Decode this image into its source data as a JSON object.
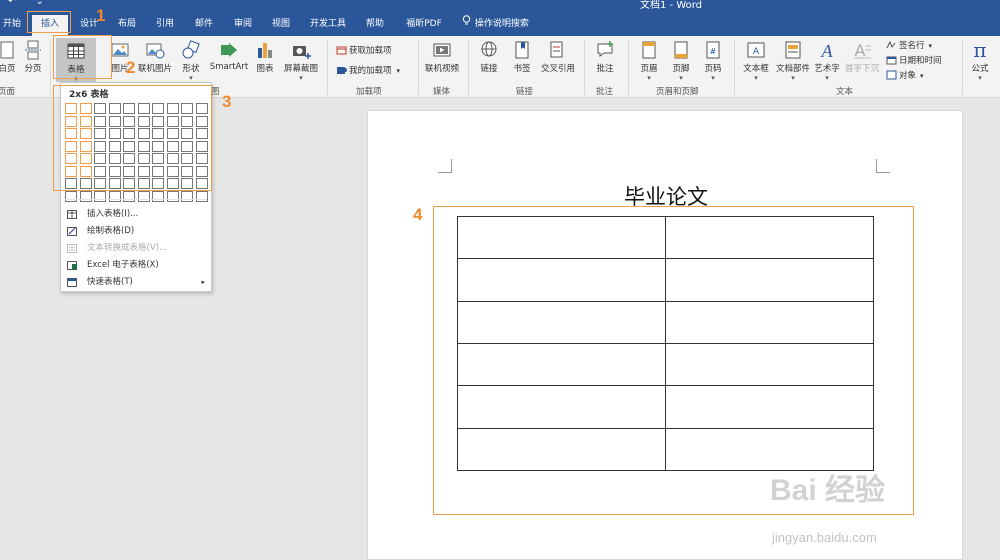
{
  "titlebar": {
    "title": "文档1 - Word",
    "quick_access": "↶ ⌄"
  },
  "tabs": [
    {
      "label": "开始"
    },
    {
      "label": "插入"
    },
    {
      "label": "设计"
    },
    {
      "label": "布局"
    },
    {
      "label": "引用"
    },
    {
      "label": "邮件"
    },
    {
      "label": "审阅"
    },
    {
      "label": "视图"
    },
    {
      "label": "开发工具"
    },
    {
      "label": "帮助"
    },
    {
      "label": "福昕PDF"
    }
  ],
  "tell_me": "操作说明搜索",
  "ribbon": {
    "pages_group": {
      "blank_page": "白页",
      "page_break": "分页",
      "label": "页面"
    },
    "table_btn": "表格",
    "pictures": "图片",
    "online_pictures": "联机图片",
    "shapes": "形状",
    "smartart": "SmartArt",
    "chart": "图表",
    "screenshot": "屏幕截图",
    "illustrations_label": "图",
    "get_addins": "获取加载项",
    "my_addins": "我的加载项",
    "addins_label": "加载项",
    "online_video": "联机视频",
    "media_label": "媒体",
    "link": "链接",
    "bookmark": "书签",
    "cross_ref": "交叉引用",
    "links_label": "链接",
    "comment": "批注",
    "comments_label": "批注",
    "header": "页眉",
    "footer": "页脚",
    "page_number": "页码",
    "header_footer_label": "页眉和页脚",
    "textbox": "文本框",
    "quick_parts": "文档部件",
    "wordart": "艺术字",
    "dropcap": "首字下沉",
    "signature": "签名行",
    "datetime": "日期和时间",
    "object": "对象",
    "text_label": "文本",
    "equation": "公式",
    "pi": "π"
  },
  "dropdown": {
    "grid_title": "2x6 表格",
    "grid_cols": 10,
    "grid_rows": 8,
    "sel_cols": 2,
    "sel_rows": 6,
    "items": [
      {
        "label": "插入表格(I)..."
      },
      {
        "label": "绘制表格(D)"
      },
      {
        "label": "文本转换成表格(V)..."
      },
      {
        "label": "Excel 电子表格(X)"
      },
      {
        "label": "快速表格(T)",
        "arrow": "▸"
      }
    ]
  },
  "document": {
    "heading": "毕业论文",
    "table_rows": 6,
    "table_cols": 2
  },
  "annotations": {
    "n1": "1",
    "n2": "2",
    "n3": "3",
    "n4": "4"
  },
  "watermark": {
    "logo": "Bai 经验",
    "url": "jingyan.baidu.com"
  },
  "colors": {
    "accent": "#2b579a",
    "annotation": "#f39c4a"
  }
}
